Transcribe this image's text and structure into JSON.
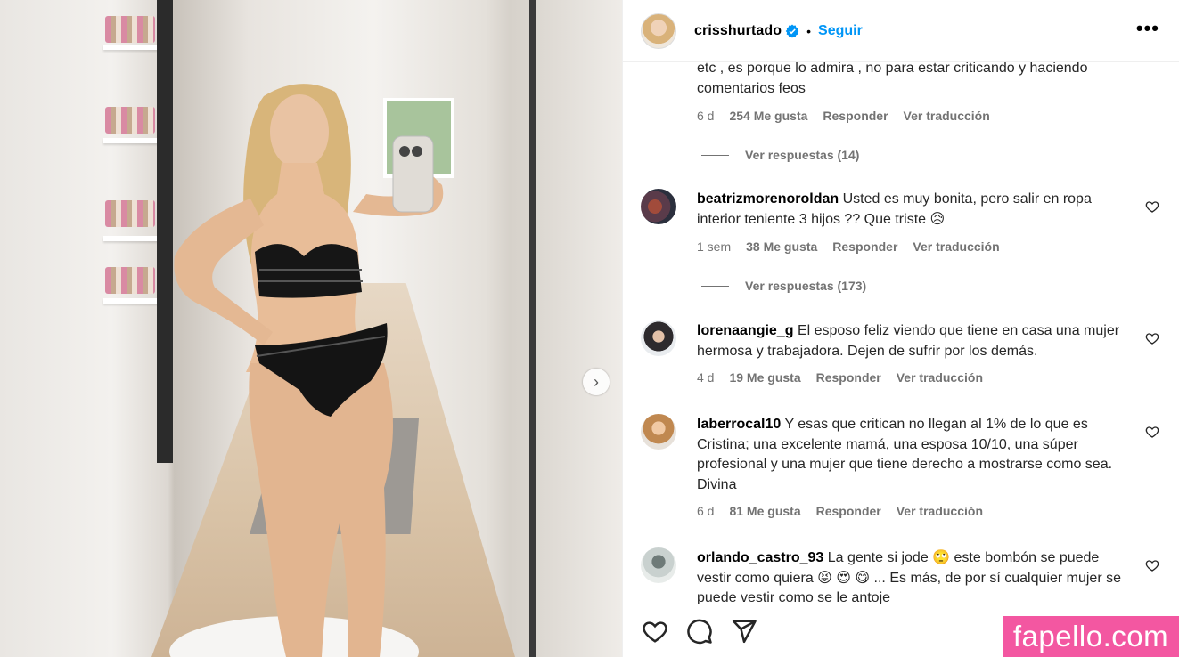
{
  "post": {
    "username": "crisshurtado",
    "separator": "•",
    "follow_label": "Seguir",
    "more_label": "•••"
  },
  "comments": [
    {
      "text": "etc , es porque lo admira , no para estar criticando y haciendo comentarios feos",
      "time": "6 d",
      "likes": "254 Me gusta",
      "reply_label": "Responder",
      "translate_label": "Ver traducción",
      "replies_label": "Ver respuestas (14)"
    },
    {
      "username": "beatrizmorenoroldan",
      "text": "Usted es muy bonita, pero salir en ropa interior teniente 3 hijos ?? Que triste 😥",
      "time": "1 sem",
      "likes": "38 Me gusta",
      "reply_label": "Responder",
      "translate_label": "Ver traducción",
      "replies_label": "Ver respuestas (173)"
    },
    {
      "username": "lorenaangie_g",
      "text": "El esposo feliz viendo que tiene en casa una mujer hermosa y trabajadora. Dejen de sufrir por los demás.",
      "time": "4 d",
      "likes": "19 Me gusta",
      "reply_label": "Responder",
      "translate_label": "Ver traducción"
    },
    {
      "username": "laberrocal10",
      "text": "Y esas que critican no llegan al 1% de lo que es Cristina; una excelente mamá, una esposa 10/10, una súper profesional y una mujer que tiene derecho a mostrarse como sea. Divina",
      "time": "6 d",
      "likes": "81 Me gusta",
      "reply_label": "Responder",
      "translate_label": "Ver traducción"
    },
    {
      "username": "orlando_castro_93",
      "text": "La gente si jode 🙄  este bombón se puede vestir como quiera 😝 😍 😋  ... Es más, de por sí cualquier mujer se puede vestir como se le antoje",
      "time": "",
      "likes": "",
      "reply_label": "",
      "translate_label": ""
    }
  ],
  "watermark": "fapello.com",
  "icons": {
    "verified": "verified-badge-icon",
    "like": "heart-icon",
    "comment": "comment-icon",
    "share": "send-icon",
    "next": "chevron-right-icon"
  },
  "colors": {
    "accent": "#0095f6",
    "muted": "#737373",
    "watermark_bg": "#f357a1"
  }
}
